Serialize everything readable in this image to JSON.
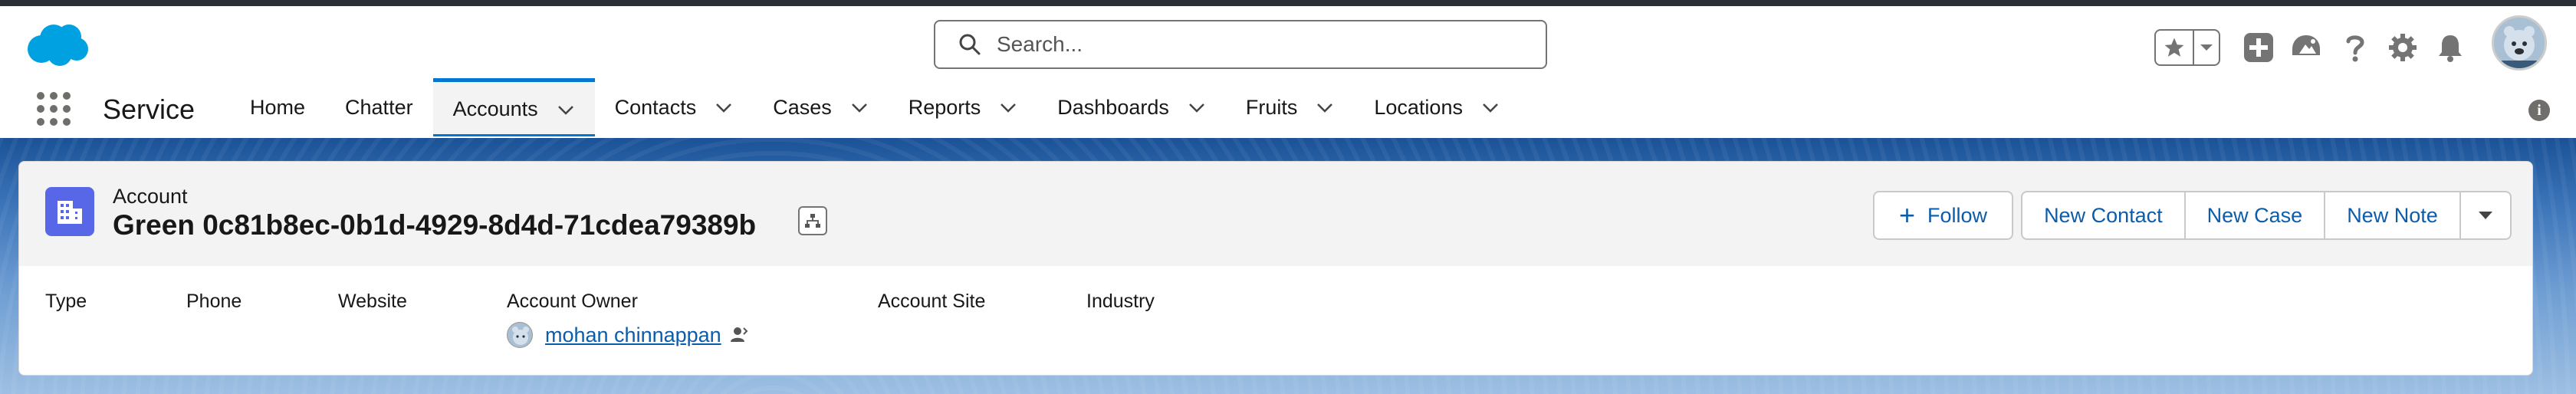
{
  "header": {
    "search_placeholder": "Search...",
    "icons": [
      "salesforce-cloud-logo",
      "search-icon",
      "star-icon",
      "chevron-down-icon",
      "add-icon",
      "trailhead-icon",
      "help-icon",
      "gear-icon",
      "bell-icon",
      "avatar"
    ]
  },
  "nav": {
    "app_name": "Service",
    "items": [
      {
        "label": "Home",
        "has_menu": false,
        "active": false
      },
      {
        "label": "Chatter",
        "has_menu": false,
        "active": false
      },
      {
        "label": "Accounts",
        "has_menu": true,
        "active": true
      },
      {
        "label": "Contacts",
        "has_menu": true,
        "active": false
      },
      {
        "label": "Cases",
        "has_menu": true,
        "active": false
      },
      {
        "label": "Reports",
        "has_menu": true,
        "active": false
      },
      {
        "label": "Dashboards",
        "has_menu": true,
        "active": false
      },
      {
        "label": "Fruits",
        "has_menu": true,
        "active": false
      },
      {
        "label": "Locations",
        "has_menu": true,
        "active": false
      }
    ]
  },
  "record": {
    "object_label": "Account",
    "title": "Green 0c81b8ec-0b1d-4929-8d4d-71cdea79389b",
    "actions": {
      "follow": "Follow",
      "new_contact": "New Contact",
      "new_case": "New Case",
      "new_note": "New Note"
    },
    "fields": {
      "type": "Type",
      "phone": "Phone",
      "website": "Website",
      "account_owner": "Account Owner",
      "owner_name": "mohan chinnappan",
      "account_site": "Account Site",
      "industry": "Industry"
    }
  },
  "colors": {
    "brand_blue": "#0176d3",
    "link_blue": "#0b5cab",
    "account_icon": "#5867e8",
    "cloud": "#00a1e0"
  }
}
